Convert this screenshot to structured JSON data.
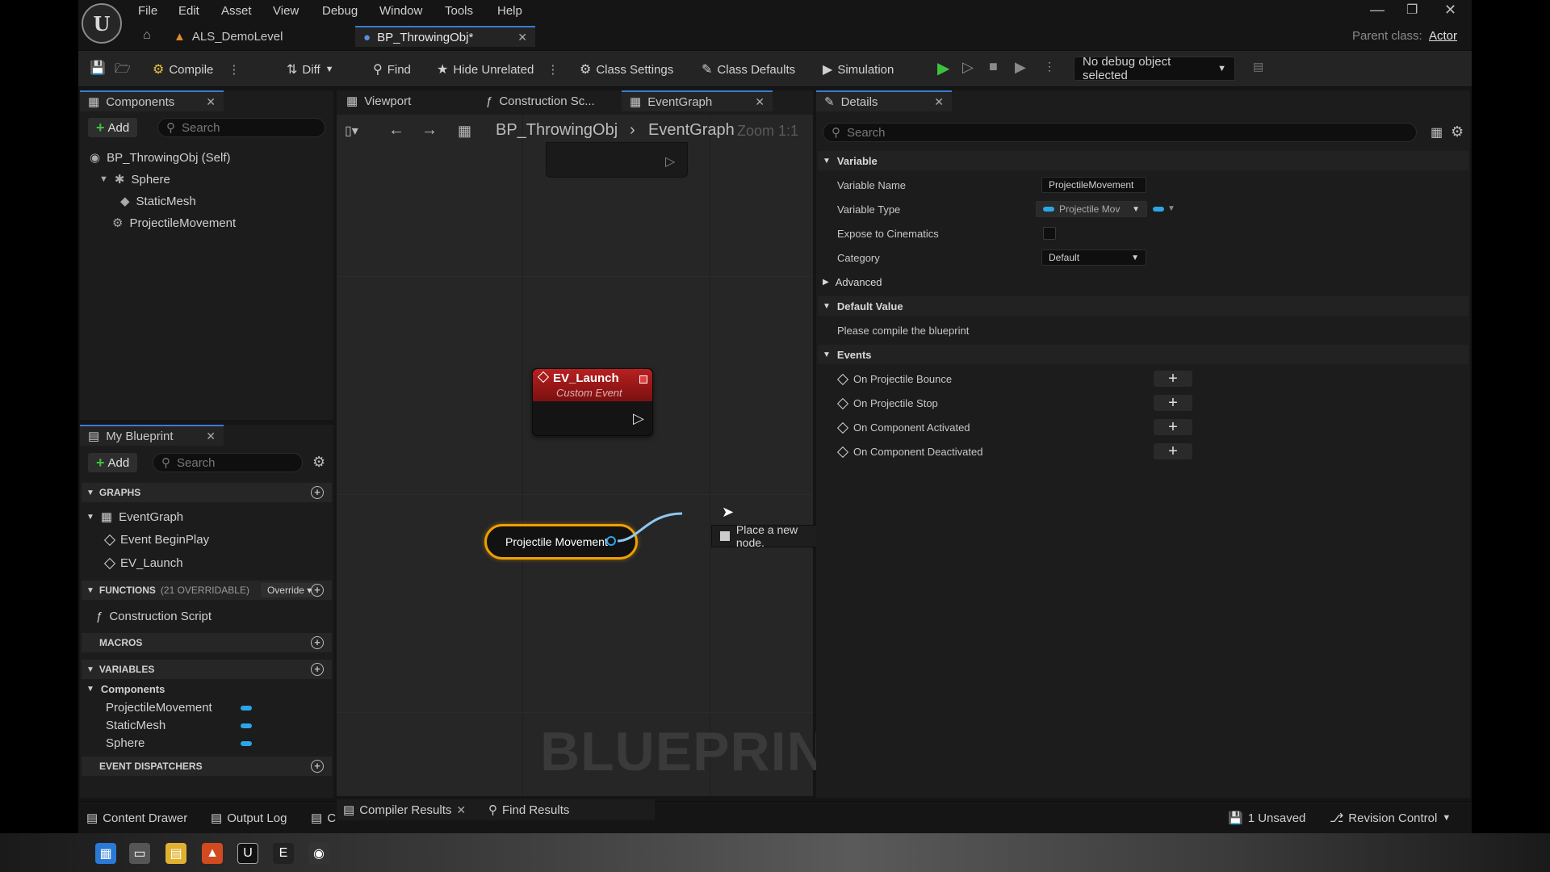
{
  "menu": [
    "File",
    "Edit",
    "View",
    "Asset",
    "Debug",
    "Window",
    "Tools",
    "Help"
  ],
  "menu_order_labels": {
    "file": "File",
    "edit": "Edit",
    "asset": "Asset",
    "view": "View",
    "debug": "Debug",
    "window": "Window",
    "tools": "Tools",
    "help": "Help"
  },
  "tabs": {
    "level": "ALS_DemoLevel",
    "blueprint": "BP_ThrowingObj*"
  },
  "parent_class": {
    "label": "Parent class:",
    "value": "Actor"
  },
  "toolbar": {
    "compile": "Compile",
    "diff": "Diff",
    "find": "Find",
    "hide_unrelated": "Hide Unrelated",
    "class_settings": "Class Settings",
    "class_defaults": "Class Defaults",
    "simulation": "Simulation",
    "debug_object": "No debug object selected"
  },
  "components": {
    "title": "Components",
    "add": "Add",
    "search_placeholder": "Search",
    "items": [
      "BP_ThrowingObj (Self)",
      "Sphere",
      "StaticMesh",
      "ProjectileMovement"
    ]
  },
  "my_blueprint": {
    "title": "My Blueprint",
    "add": "Add",
    "search_placeholder": "Search",
    "graphs_label": "GRAPHS",
    "graphs": [
      "EventGraph",
      "Event BeginPlay",
      "EV_Launch"
    ],
    "functions_label": "FUNCTIONS",
    "functions_overridable": "(21 OVERRIDABLE)",
    "override": "Override",
    "functions": [
      "Construction Script"
    ],
    "macros_label": "MACROS",
    "variables_label": "VARIABLES",
    "components_label": "Components",
    "variables": [
      "ProjectileMovement",
      "StaticMesh",
      "Sphere"
    ],
    "event_dispatchers_label": "EVENT DISPATCHERS"
  },
  "graph_tabs": {
    "viewport": "Viewport",
    "construction": "Construction Sc...",
    "eventgraph": "EventGraph"
  },
  "breadcrumb": {
    "blueprint": "BP_ThrowingObj",
    "graph": "EventGraph",
    "zoom": "Zoom 1:1"
  },
  "nodes": {
    "ev_launch_title": "EV_Launch",
    "ev_launch_sub": "Custom Event",
    "projectile_movement": "Projectile Movement",
    "tooltip": "Place a new node.",
    "watermark": "BLUEPRINT"
  },
  "details": {
    "title": "Details",
    "search_placeholder": "Search",
    "variable_section": "Variable",
    "variable_name_label": "Variable Name",
    "variable_name_value": "ProjectileMovement",
    "variable_type_label": "Variable Type",
    "variable_type_value": "Projectile Mov",
    "expose_label": "Expose to Cinematics",
    "category_label": "Category",
    "category_value": "Default",
    "advanced": "Advanced",
    "default_value_section": "Default Value",
    "compile_msg": "Please compile the blueprint",
    "events_section": "Events",
    "events": [
      "On Projectile Bounce",
      "On Projectile Stop",
      "On Component Activated",
      "On Component Deactivated"
    ]
  },
  "bottom": {
    "content_drawer": "Content Drawer",
    "output_log": "Output Log",
    "cmd": "C",
    "compiler_results": "Compiler Results",
    "find_results": "Find Results",
    "unsaved": "1 Unsaved",
    "revision_control": "Revision Control"
  },
  "colors": {
    "accent": "#3a7bd5",
    "play_green": "#3ec13e",
    "event_red": "#a01a1a",
    "var_blue": "#2aa6e8",
    "node_outline": "#f0a000"
  }
}
